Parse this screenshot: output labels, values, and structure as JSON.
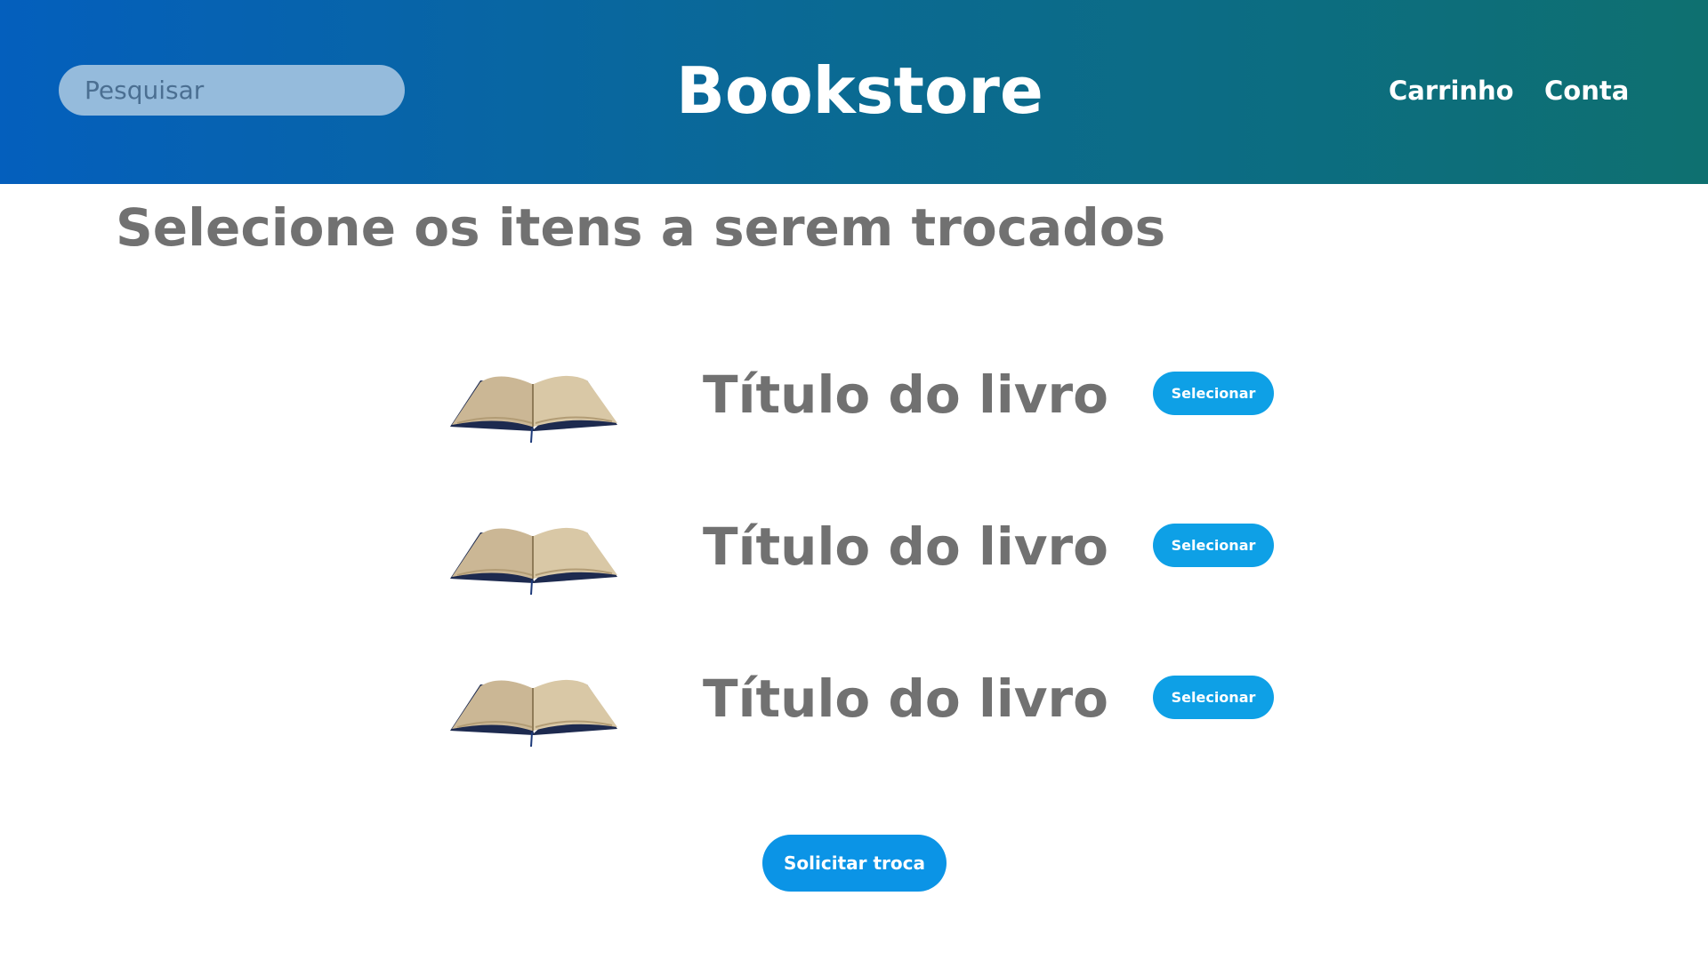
{
  "header": {
    "search_placeholder": "Pesquisar",
    "brand": "Bookstore",
    "nav": {
      "cart": "Carrinho",
      "account": "Conta"
    }
  },
  "main": {
    "title": "Selecione os itens a serem trocados",
    "items": [
      {
        "title": "Título do livro",
        "button": "Selecionar",
        "icon": "open-book-icon"
      },
      {
        "title": "Título do livro",
        "button": "Selecionar",
        "icon": "open-book-icon"
      },
      {
        "title": "Título do livro",
        "button": "Selecionar",
        "icon": "open-book-icon"
      }
    ],
    "submit_label": "Solicitar troca"
  },
  "colors": {
    "header_gradient_start": "#045fbd",
    "header_gradient_end": "#0e7070",
    "search_bg": "#95bbdc",
    "heading_text": "#717171",
    "button_bg": "#0ea0e6"
  }
}
